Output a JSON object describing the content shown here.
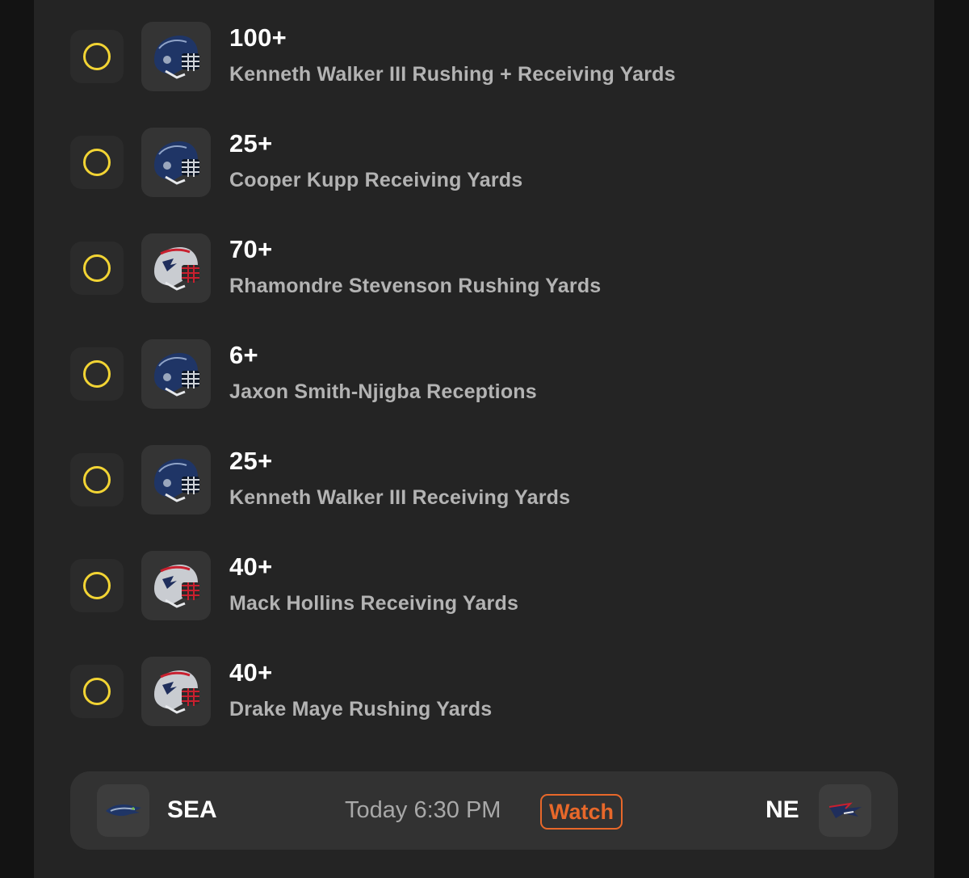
{
  "colors": {
    "background": "#131313",
    "panel": "#242424",
    "radio_accent": "#f2d434",
    "watch_accent": "#e8682a",
    "seahawks_navy": "#1f3566",
    "patriots_silver": "#c9ccd1",
    "patriots_red": "#c8202f"
  },
  "props": [
    {
      "line": "100+",
      "description": "Kenneth Walker III Rushing + Receiving Yards",
      "team": "SEA",
      "helmet_icon": "seahawks-helmet-icon",
      "selected": false
    },
    {
      "line": "25+",
      "description": "Cooper Kupp Receiving Yards",
      "team": "SEA",
      "helmet_icon": "seahawks-helmet-icon",
      "selected": false
    },
    {
      "line": "70+",
      "description": "Rhamondre Stevenson Rushing Yards",
      "team": "NE",
      "helmet_icon": "patriots-helmet-icon",
      "selected": false
    },
    {
      "line": "6+",
      "description": "Jaxon Smith-Njigba Receptions",
      "team": "SEA",
      "helmet_icon": "seahawks-helmet-icon",
      "selected": false
    },
    {
      "line": "25+",
      "description": "Kenneth Walker III Receiving Yards",
      "team": "SEA",
      "helmet_icon": "seahawks-helmet-icon",
      "selected": false
    },
    {
      "line": "40+",
      "description": "Mack Hollins Receiving Yards",
      "team": "NE",
      "helmet_icon": "patriots-helmet-icon",
      "selected": false
    },
    {
      "line": "40+",
      "description": "Drake Maye Rushing Yards",
      "team": "NE",
      "helmet_icon": "patriots-helmet-icon",
      "selected": false
    }
  ],
  "matchup": {
    "away_team": "SEA",
    "away_logo_icon": "seahawks-logo-icon",
    "home_team": "NE",
    "home_logo_icon": "patriots-logo-icon",
    "time": "Today 6:30 PM",
    "watch_label": "Watch"
  }
}
